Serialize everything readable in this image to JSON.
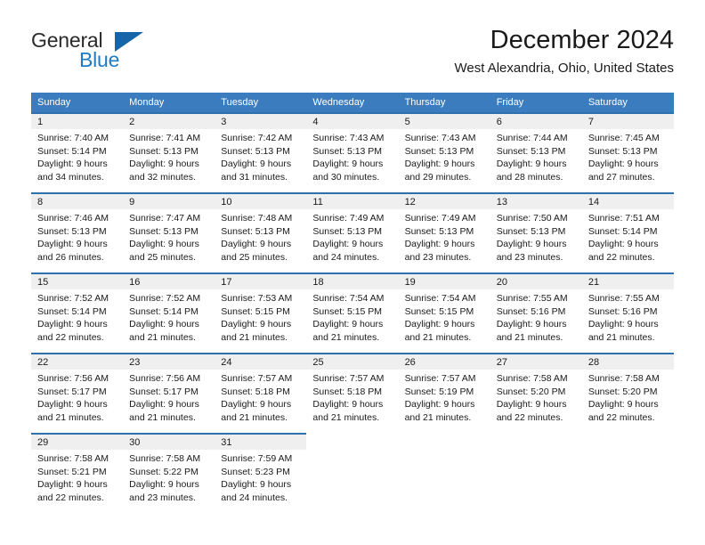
{
  "brand": {
    "name_top": "General",
    "name_bottom": "Blue",
    "logo_icon": "blue-triangle-icon",
    "color_blue": "#1f7bc4",
    "color_triangle": "#1565a8"
  },
  "header": {
    "title": "December 2024",
    "subtitle": "West Alexandria, Ohio, United States"
  },
  "theme": {
    "header_row_bg": "#3b7cbe",
    "row_rule": "#2e6fae",
    "daynum_band_bg": "#efefef",
    "text": "#1a1a1a"
  },
  "calendar": {
    "weekday_headers": [
      "Sunday",
      "Monday",
      "Tuesday",
      "Wednesday",
      "Thursday",
      "Friday",
      "Saturday"
    ],
    "weeks": [
      [
        {
          "day": "1",
          "sunrise": "Sunrise: 7:40 AM",
          "sunset": "Sunset: 5:14 PM",
          "daylight_1": "Daylight: 9 hours",
          "daylight_2": "and 34 minutes."
        },
        {
          "day": "2",
          "sunrise": "Sunrise: 7:41 AM",
          "sunset": "Sunset: 5:13 PM",
          "daylight_1": "Daylight: 9 hours",
          "daylight_2": "and 32 minutes."
        },
        {
          "day": "3",
          "sunrise": "Sunrise: 7:42 AM",
          "sunset": "Sunset: 5:13 PM",
          "daylight_1": "Daylight: 9 hours",
          "daylight_2": "and 31 minutes."
        },
        {
          "day": "4",
          "sunrise": "Sunrise: 7:43 AM",
          "sunset": "Sunset: 5:13 PM",
          "daylight_1": "Daylight: 9 hours",
          "daylight_2": "and 30 minutes."
        },
        {
          "day": "5",
          "sunrise": "Sunrise: 7:43 AM",
          "sunset": "Sunset: 5:13 PM",
          "daylight_1": "Daylight: 9 hours",
          "daylight_2": "and 29 minutes."
        },
        {
          "day": "6",
          "sunrise": "Sunrise: 7:44 AM",
          "sunset": "Sunset: 5:13 PM",
          "daylight_1": "Daylight: 9 hours",
          "daylight_2": "and 28 minutes."
        },
        {
          "day": "7",
          "sunrise": "Sunrise: 7:45 AM",
          "sunset": "Sunset: 5:13 PM",
          "daylight_1": "Daylight: 9 hours",
          "daylight_2": "and 27 minutes."
        }
      ],
      [
        {
          "day": "8",
          "sunrise": "Sunrise: 7:46 AM",
          "sunset": "Sunset: 5:13 PM",
          "daylight_1": "Daylight: 9 hours",
          "daylight_2": "and 26 minutes."
        },
        {
          "day": "9",
          "sunrise": "Sunrise: 7:47 AM",
          "sunset": "Sunset: 5:13 PM",
          "daylight_1": "Daylight: 9 hours",
          "daylight_2": "and 25 minutes."
        },
        {
          "day": "10",
          "sunrise": "Sunrise: 7:48 AM",
          "sunset": "Sunset: 5:13 PM",
          "daylight_1": "Daylight: 9 hours",
          "daylight_2": "and 25 minutes."
        },
        {
          "day": "11",
          "sunrise": "Sunrise: 7:49 AM",
          "sunset": "Sunset: 5:13 PM",
          "daylight_1": "Daylight: 9 hours",
          "daylight_2": "and 24 minutes."
        },
        {
          "day": "12",
          "sunrise": "Sunrise: 7:49 AM",
          "sunset": "Sunset: 5:13 PM",
          "daylight_1": "Daylight: 9 hours",
          "daylight_2": "and 23 minutes."
        },
        {
          "day": "13",
          "sunrise": "Sunrise: 7:50 AM",
          "sunset": "Sunset: 5:13 PM",
          "daylight_1": "Daylight: 9 hours",
          "daylight_2": "and 23 minutes."
        },
        {
          "day": "14",
          "sunrise": "Sunrise: 7:51 AM",
          "sunset": "Sunset: 5:14 PM",
          "daylight_1": "Daylight: 9 hours",
          "daylight_2": "and 22 minutes."
        }
      ],
      [
        {
          "day": "15",
          "sunrise": "Sunrise: 7:52 AM",
          "sunset": "Sunset: 5:14 PM",
          "daylight_1": "Daylight: 9 hours",
          "daylight_2": "and 22 minutes."
        },
        {
          "day": "16",
          "sunrise": "Sunrise: 7:52 AM",
          "sunset": "Sunset: 5:14 PM",
          "daylight_1": "Daylight: 9 hours",
          "daylight_2": "and 21 minutes."
        },
        {
          "day": "17",
          "sunrise": "Sunrise: 7:53 AM",
          "sunset": "Sunset: 5:15 PM",
          "daylight_1": "Daylight: 9 hours",
          "daylight_2": "and 21 minutes."
        },
        {
          "day": "18",
          "sunrise": "Sunrise: 7:54 AM",
          "sunset": "Sunset: 5:15 PM",
          "daylight_1": "Daylight: 9 hours",
          "daylight_2": "and 21 minutes."
        },
        {
          "day": "19",
          "sunrise": "Sunrise: 7:54 AM",
          "sunset": "Sunset: 5:15 PM",
          "daylight_1": "Daylight: 9 hours",
          "daylight_2": "and 21 minutes."
        },
        {
          "day": "20",
          "sunrise": "Sunrise: 7:55 AM",
          "sunset": "Sunset: 5:16 PM",
          "daylight_1": "Daylight: 9 hours",
          "daylight_2": "and 21 minutes."
        },
        {
          "day": "21",
          "sunrise": "Sunrise: 7:55 AM",
          "sunset": "Sunset: 5:16 PM",
          "daylight_1": "Daylight: 9 hours",
          "daylight_2": "and 21 minutes."
        }
      ],
      [
        {
          "day": "22",
          "sunrise": "Sunrise: 7:56 AM",
          "sunset": "Sunset: 5:17 PM",
          "daylight_1": "Daylight: 9 hours",
          "daylight_2": "and 21 minutes."
        },
        {
          "day": "23",
          "sunrise": "Sunrise: 7:56 AM",
          "sunset": "Sunset: 5:17 PM",
          "daylight_1": "Daylight: 9 hours",
          "daylight_2": "and 21 minutes."
        },
        {
          "day": "24",
          "sunrise": "Sunrise: 7:57 AM",
          "sunset": "Sunset: 5:18 PM",
          "daylight_1": "Daylight: 9 hours",
          "daylight_2": "and 21 minutes."
        },
        {
          "day": "25",
          "sunrise": "Sunrise: 7:57 AM",
          "sunset": "Sunset: 5:18 PM",
          "daylight_1": "Daylight: 9 hours",
          "daylight_2": "and 21 minutes."
        },
        {
          "day": "26",
          "sunrise": "Sunrise: 7:57 AM",
          "sunset": "Sunset: 5:19 PM",
          "daylight_1": "Daylight: 9 hours",
          "daylight_2": "and 21 minutes."
        },
        {
          "day": "27",
          "sunrise": "Sunrise: 7:58 AM",
          "sunset": "Sunset: 5:20 PM",
          "daylight_1": "Daylight: 9 hours",
          "daylight_2": "and 22 minutes."
        },
        {
          "day": "28",
          "sunrise": "Sunrise: 7:58 AM",
          "sunset": "Sunset: 5:20 PM",
          "daylight_1": "Daylight: 9 hours",
          "daylight_2": "and 22 minutes."
        }
      ],
      [
        {
          "day": "29",
          "sunrise": "Sunrise: 7:58 AM",
          "sunset": "Sunset: 5:21 PM",
          "daylight_1": "Daylight: 9 hours",
          "daylight_2": "and 22 minutes."
        },
        {
          "day": "30",
          "sunrise": "Sunrise: 7:58 AM",
          "sunset": "Sunset: 5:22 PM",
          "daylight_1": "Daylight: 9 hours",
          "daylight_2": "and 23 minutes."
        },
        {
          "day": "31",
          "sunrise": "Sunrise: 7:59 AM",
          "sunset": "Sunset: 5:23 PM",
          "daylight_1": "Daylight: 9 hours",
          "daylight_2": "and 24 minutes."
        },
        null,
        null,
        null,
        null
      ]
    ]
  }
}
